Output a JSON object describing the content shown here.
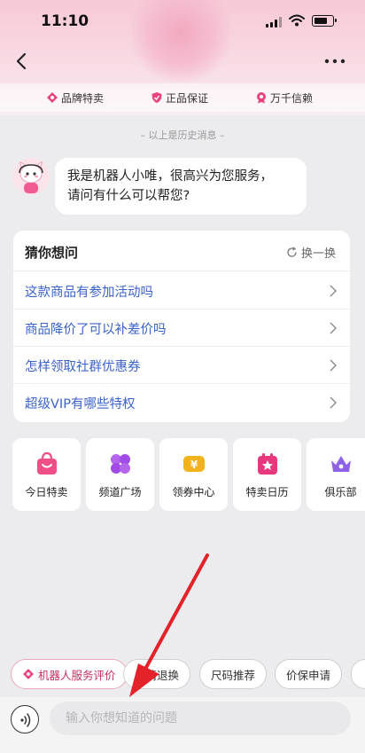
{
  "status_bar": {
    "time": "11:10"
  },
  "trust_badges": [
    "品牌特卖",
    "正品保证",
    "万千信赖"
  ],
  "history_tip": "– 以上是历史消息 –",
  "bot_message": {
    "line1": "我是机器人小唯，很高兴为您服务，",
    "line2": "请问有什么可以帮您?"
  },
  "guess": {
    "title": "猜你想问",
    "refresh_label": "换一换",
    "questions": [
      "这款商品有参加活动吗",
      "商品降价了可以补差价吗",
      "怎样领取社群优惠券",
      "超级VIP有哪些特权"
    ]
  },
  "shortcuts": [
    {
      "label": "今日特卖",
      "icon": "gift-bag-icon",
      "color": "#ef4f86"
    },
    {
      "label": "频道广场",
      "icon": "clover-icon",
      "color": "#a04be6"
    },
    {
      "label": "领券中心",
      "icon": "coupon-icon",
      "color": "#f2b21c"
    },
    {
      "label": "特卖日历",
      "icon": "calendar-star-icon",
      "color": "#e8377c"
    },
    {
      "label": "俱乐部",
      "icon": "crown-icon",
      "color": "#8e63e8"
    }
  ],
  "quick_chips": [
    "机器人服务评价",
    "申请退换",
    "尺码推荐",
    "价保申请"
  ],
  "input": {
    "placeholder": "输入你想知道的问题"
  },
  "colors": {
    "accent_pink": "#e9457a",
    "link_blue": "#3a62c9",
    "arrow_red": "#e3222a"
  }
}
